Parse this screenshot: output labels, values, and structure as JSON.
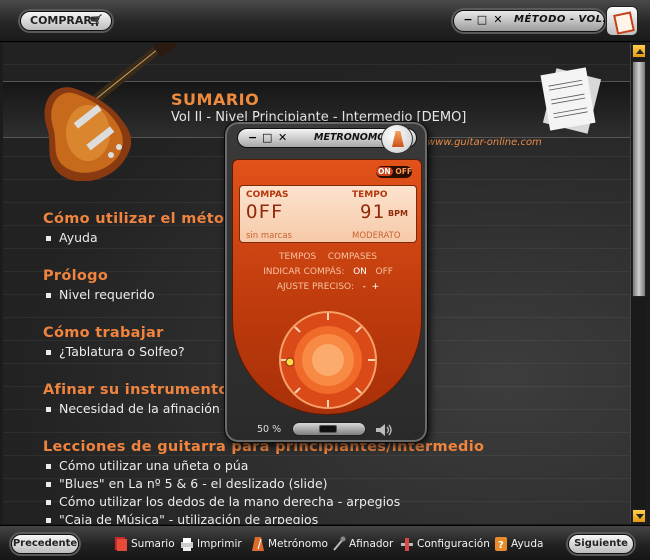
{
  "topbar": {
    "buy_label": "COMPRAR",
    "window_title": "MÉTODO - VOL. II"
  },
  "header": {
    "title": "SUMARIO",
    "subtitle": "Vol II - Nivel Principiante - Intermedio [DEMO]",
    "site": "www.guitar-online.com"
  },
  "sections": [
    {
      "title": "Cómo utilizar el método",
      "items": [
        "Ayuda"
      ]
    },
    {
      "title": "Prólogo",
      "items": [
        "Nivel requerido"
      ]
    },
    {
      "title": "Cómo trabajar",
      "items": [
        "¿Tablatura o Solfeo?"
      ]
    },
    {
      "title": "Afinar su instrumento",
      "items": [
        "Necesidad de la afinación"
      ]
    },
    {
      "title": "Lecciones de guitarra para principiantes/intermedio",
      "items": [
        "Cómo utilizar una uñeta o púa",
        "\"Blues\" en La nº 5 & 6 - el deslizado (slide)",
        "Cómo utilizar los dedos de la mano derecha - arpegios",
        "\"Caja de Música\" - utilización de arpegios"
      ]
    }
  ],
  "metronome": {
    "title": "METRONOMO",
    "on_label": "ON",
    "off_label": "OFF",
    "compas_label": "COMPAS",
    "compas_value": "OFF",
    "tempo_label": "TEMPO",
    "tempo_value": "91",
    "bpm_label": "BPM",
    "marks_label": "sin marcas",
    "tempo_name": "MODERATO",
    "tabs": [
      "TEMPOS",
      "COMPASES"
    ],
    "indicar_label": "INDICAR COMPÁS:",
    "indicar_on": "ON",
    "indicar_off": "OFF",
    "ajuste_label": "AJUSTE PRECISO:",
    "ajuste_minus": "-",
    "ajuste_plus": "+",
    "volume": "50 %",
    "volume_fraction": 0.5
  },
  "bottombar": {
    "prev_label": "Precedente",
    "next_label": "Siguiente",
    "items": [
      "Sumario",
      "Imprimir",
      "Metrónomo",
      "Afinador",
      "Configuración",
      "Ayuda"
    ]
  },
  "colors": {
    "accent": "#f0843f",
    "metronome_body": "#d8481a",
    "scroll_arrow": "#f5b025"
  }
}
